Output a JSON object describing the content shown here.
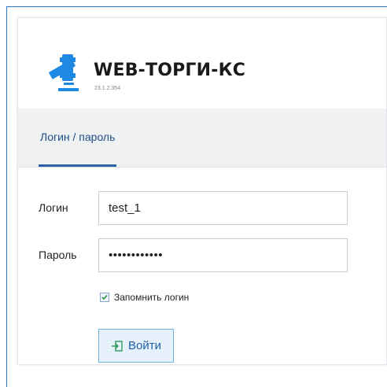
{
  "app": {
    "title": "WEB-ТОРГИ-КС",
    "version": "23.1.2.354"
  },
  "tabs": [
    {
      "label": "Логин / пароль",
      "active": true
    }
  ],
  "form": {
    "login_label": "Логин",
    "login_value": "test_1",
    "password_label": "Пароль",
    "password_value": "••••••••••••",
    "remember_label": "Запомнить логин",
    "remember_checked": true,
    "submit_label": "Войти"
  },
  "icons": {
    "logo": "gavel-logo-icon",
    "checkbox": "checkmark-icon",
    "submit": "sign-in-icon"
  },
  "colors": {
    "accent": "#2b62a6",
    "logo_blue": "#1e88e5",
    "tab_bg": "#eff1f3",
    "button_bg": "#e6f1fb",
    "button_border": "#6fb0e0"
  }
}
